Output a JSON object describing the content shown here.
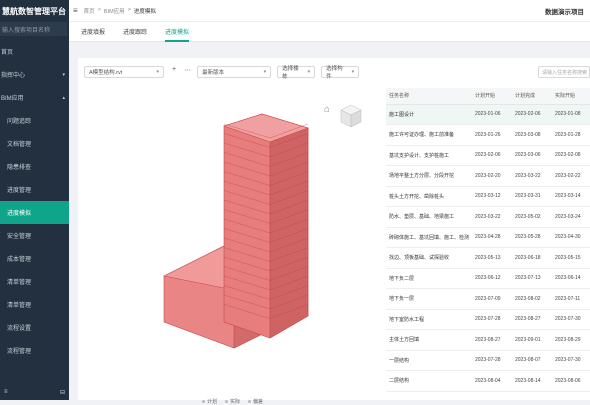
{
  "app": {
    "title": "慧航数智管理平台",
    "search_placeholder": "输入搜索项目名称"
  },
  "sidebar": {
    "items": [
      {
        "label": "首页",
        "level": 1
      },
      {
        "label": "指挥中心",
        "level": 1,
        "arrow": "▾"
      },
      {
        "label": "BIM应用",
        "level": 1,
        "arrow": "▴"
      },
      {
        "label": "问题追踪",
        "level": 2
      },
      {
        "label": "文档管理",
        "level": 2
      },
      {
        "label": "隐患排查",
        "level": 2
      },
      {
        "label": "进度管理",
        "level": 2
      },
      {
        "label": "进度模拟",
        "level": 2,
        "active": true
      },
      {
        "label": "安全管理",
        "level": 2
      },
      {
        "label": "成本管理",
        "level": 2
      },
      {
        "label": "清单管理",
        "level": 2
      },
      {
        "label": "清单管理",
        "level": 2
      },
      {
        "label": "流程设置",
        "level": 2
      },
      {
        "label": "流程管理",
        "level": 2
      }
    ],
    "footer_left": "≡",
    "footer_right": "⊟"
  },
  "topbar": {
    "collapse_icon": "≡",
    "crumbs": [
      "首页",
      ">",
      "BIM应用",
      ">",
      "进度模拟"
    ],
    "user": "数据演示项目"
  },
  "tabs": [
    {
      "label": "进度填报",
      "active": false
    },
    {
      "label": "进度跟踪",
      "active": false
    },
    {
      "label": "进度模拟",
      "active": true
    }
  ],
  "filters": {
    "model": "A模型结构.rvt",
    "version": "最新版本",
    "building": "选择楼栋",
    "component": "选择构件",
    "search_placeholder": "请输入任务名称搜索"
  },
  "legend": [
    "计划",
    "实际",
    "偏差"
  ],
  "table": {
    "headers": [
      "任务名称",
      "计划开始",
      "计划完成",
      "实际开始"
    ],
    "rows": [
      [
        "施工图设计",
        "2023-01-06",
        "2023-02-06",
        "2023-01-08"
      ],
      [
        "施工许可证办理、施工前准备",
        "2023-01-26",
        "2023-03-08",
        "2023-01-28"
      ],
      [
        "基坑支护设计、支护桩施工",
        "2023-02-06",
        "2023-03-06",
        "2023-02-08"
      ],
      [
        "场地平整土方分层、分段开挖",
        "2023-02-20",
        "2023-03-22",
        "2023-02-22"
      ],
      [
        "桩头土方开挖、凿除桩头",
        "2023-03-12",
        "2023-03-31",
        "2023-03-14"
      ],
      [
        "防水、垫层、基础、地梁施工",
        "2023-03-22",
        "2023-05-02",
        "2023-03-24"
      ],
      [
        "砖砌体施工、基坑回填、施工、检测",
        "2023-04-28",
        "2023-05-28",
        "2023-04-30"
      ],
      [
        "找边、顶板基础、试探验收",
        "2023-05-13",
        "2023-06-18",
        "2023-05-15"
      ],
      [
        "地下负二层",
        "2023-06-12",
        "2023-07-13",
        "2023-06-14"
      ],
      [
        "地下负一层",
        "2023-07-09",
        "2023-08-02",
        "2023-07-11"
      ],
      [
        "地下室防水工程",
        "2023-07-28",
        "2023-08-27",
        "2023-07-30"
      ],
      [
        "主体土方回填",
        "2023-08-27",
        "2023-09-01",
        "2023-08-29"
      ],
      [
        "一层结构",
        "2023-07-28",
        "2023-08-07",
        "2023-07-30"
      ],
      [
        "二层结构",
        "2023-08-04",
        "2023-08-14",
        "2023-08-06"
      ]
    ]
  },
  "colors": {
    "accent": "#0fa58a",
    "sidebar": "#22303f",
    "model": "#e06b6b"
  }
}
